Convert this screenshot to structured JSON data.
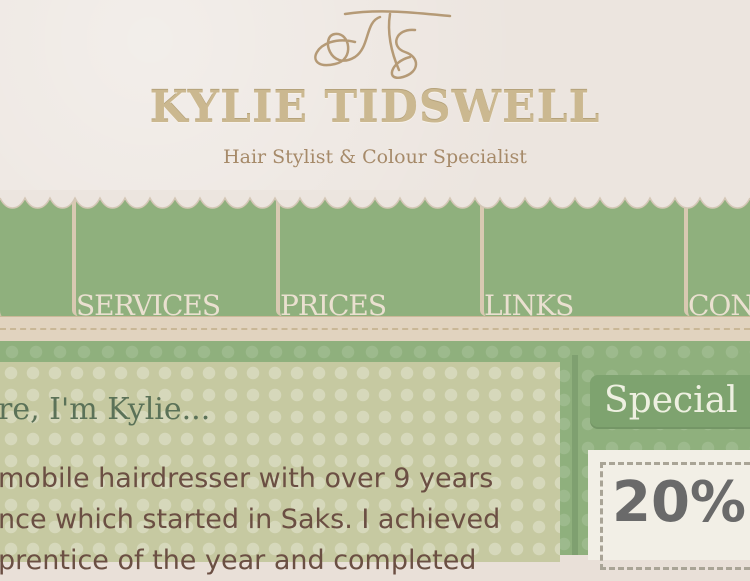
{
  "header": {
    "site_title": "KYLIE TIDSWELL",
    "tagline": "Hair Stylist & Colour Specialist",
    "logo_icon": "signature-monogram-icon"
  },
  "nav": {
    "items": [
      {
        "label": ""
      },
      {
        "label": "SERVICES"
      },
      {
        "label": "PRICES"
      },
      {
        "label": "LINKS"
      },
      {
        "label": "CON"
      }
    ]
  },
  "main": {
    "heading": "re, I'm Kylie...",
    "lines": [
      "mobile hairdresser with over 9 years",
      "nce which started in Saks. I achieved",
      "prentice of the year and completed"
    ]
  },
  "sidebar": {
    "special_title": "Special O",
    "coupon_value": "20%"
  },
  "colors": {
    "nav_green": "#8fb07d",
    "header_cream": "#ece5df",
    "title_tan": "#cbb890",
    "text_brown": "#6b4f43",
    "heading_green": "#5b7258"
  }
}
